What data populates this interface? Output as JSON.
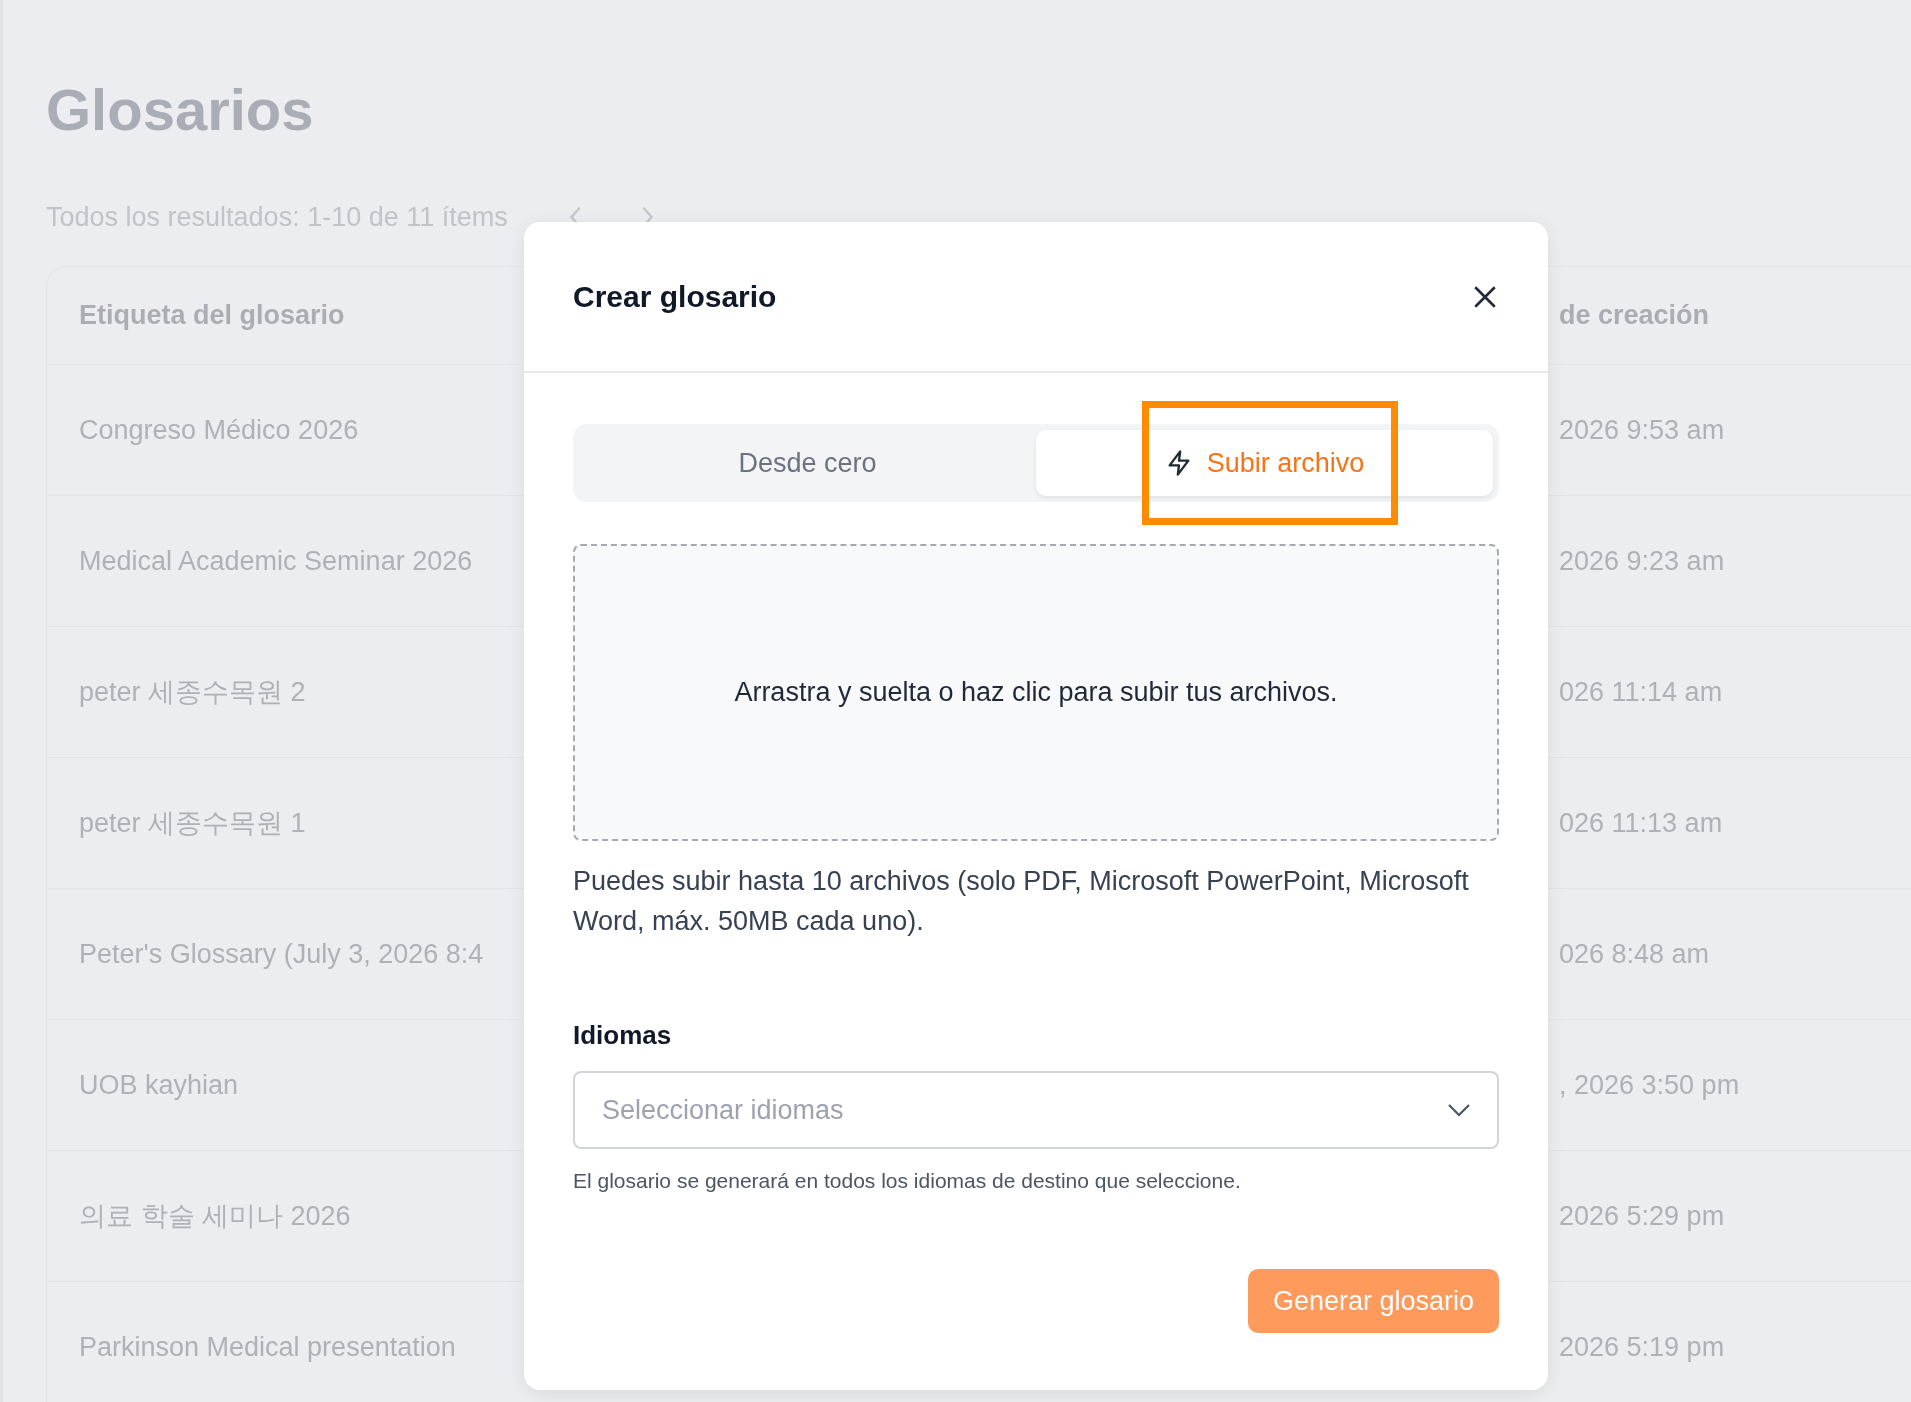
{
  "page": {
    "title": "Glosarios",
    "results": "Todos los resultados: 1-10 de 11 ítems"
  },
  "table": {
    "columns": [
      "Etiqueta del glosario",
      "de creación"
    ],
    "rows": [
      [
        "Congreso Médico 2026",
        "2026 9:53 am"
      ],
      [
        "Medical Academic Seminar 2026",
        "2026 9:23 am"
      ],
      [
        "peter 세종수목원 2",
        "026 11:14 am"
      ],
      [
        "peter 세종수목원 1",
        "026 11:13 am"
      ],
      [
        "Peter's Glossary (July 3, 2026 8:4",
        "026 8:48 am"
      ],
      [
        "UOB kayhian",
        ", 2026 3:50 pm"
      ],
      [
        "의료 학술 세미나 2026",
        "2026 5:29 pm"
      ],
      [
        "Parkinson Medical presentation",
        "2026 5:19 pm"
      ]
    ]
  },
  "dialog": {
    "title": "Crear glosario",
    "tabs": [
      {
        "label": "Desde cero",
        "selected": false,
        "kind": "plain"
      },
      {
        "label": "Subir archivo",
        "selected": true,
        "kind": "bolt"
      }
    ],
    "dropzone": "Arrastra y suelta o haz clic para subir tus archivos.",
    "help": "Puedes subir hasta 10 archivos (solo PDF, Microsoft PowerPoint, Microsoft Word, máx. 50MB cada uno).",
    "languages": {
      "label": "Idiomas",
      "placeholder": "Seleccionar idiomas",
      "hint": "El glosario se generará en todos los idiomas de destino que seleccione."
    },
    "submit": "Generar glosario"
  }
}
